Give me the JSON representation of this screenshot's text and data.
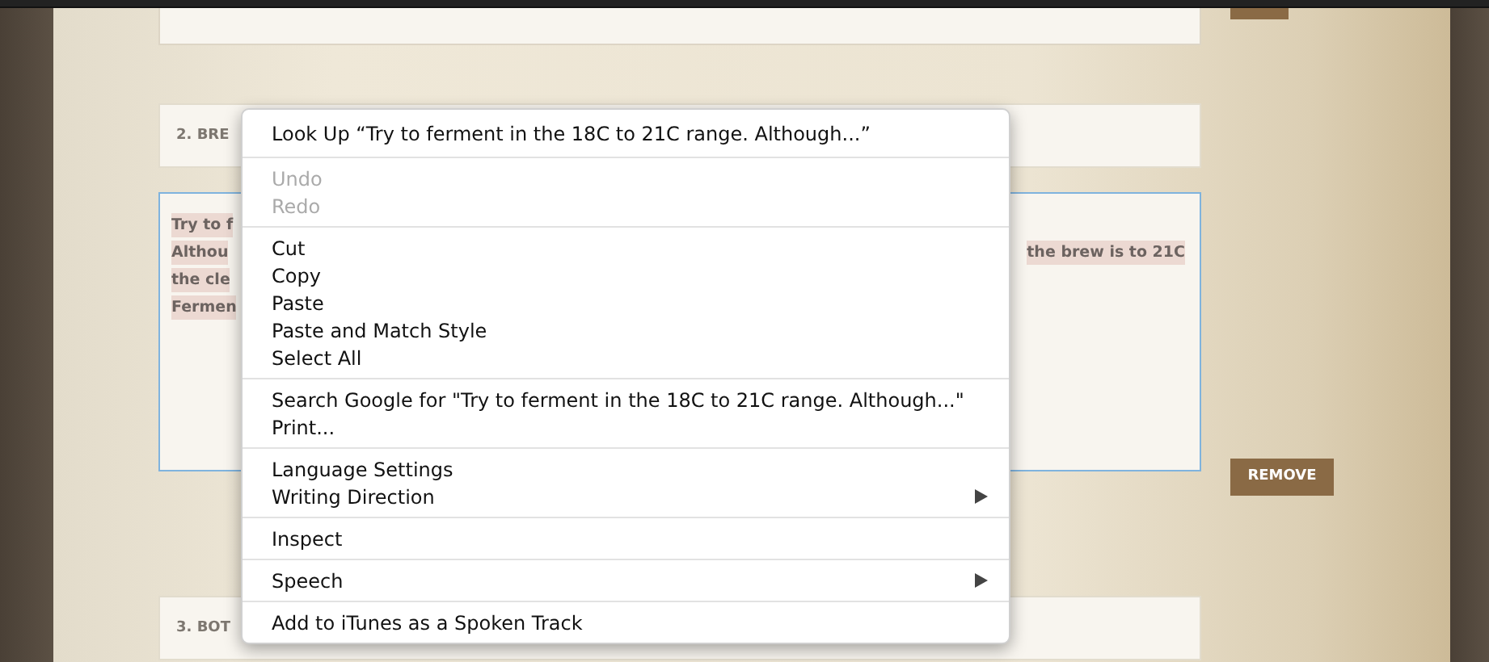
{
  "sections": [
    {
      "kind": "textarea"
    },
    {
      "kind": "header",
      "label": "2. BRE"
    },
    {
      "kind": "textarea",
      "focused": true,
      "lines": [
        {
          "left": "Try to f"
        },
        {
          "left": "Althou",
          "right": "the brew is to 21C"
        },
        {
          "left": "the cle"
        },
        {
          "left": "Fermen"
        }
      ],
      "button": "REMOVE"
    },
    {
      "kind": "header",
      "label": "3. BOT"
    }
  ],
  "context_menu": {
    "groups": [
      [
        {
          "label": "Look Up “Try to ferment in the 18C to 21C range. Although...”",
          "disabled": false,
          "submenu": false
        }
      ],
      [
        {
          "label": "Undo",
          "disabled": true,
          "submenu": false
        },
        {
          "label": "Redo",
          "disabled": true,
          "submenu": false
        }
      ],
      [
        {
          "label": "Cut",
          "disabled": false,
          "submenu": false
        },
        {
          "label": "Copy",
          "disabled": false,
          "submenu": false
        },
        {
          "label": "Paste",
          "disabled": false,
          "submenu": false
        },
        {
          "label": "Paste and Match Style",
          "disabled": false,
          "submenu": false
        },
        {
          "label": "Select All",
          "disabled": false,
          "submenu": false
        }
      ],
      [
        {
          "label": "Search Google for \"Try to ferment in the 18C to 21C range. Although...\"",
          "disabled": false,
          "submenu": false
        },
        {
          "label": "Print...",
          "disabled": false,
          "submenu": false
        }
      ],
      [
        {
          "label": "Language Settings",
          "disabled": false,
          "submenu": false
        },
        {
          "label": "Writing Direction",
          "disabled": false,
          "submenu": true
        }
      ],
      [
        {
          "label": "Inspect",
          "disabled": false,
          "submenu": false
        }
      ],
      [
        {
          "label": "Speech",
          "disabled": false,
          "submenu": true
        }
      ],
      [
        {
          "label": "Add to iTunes as a Spoken Track",
          "disabled": false,
          "submenu": false
        }
      ]
    ]
  }
}
